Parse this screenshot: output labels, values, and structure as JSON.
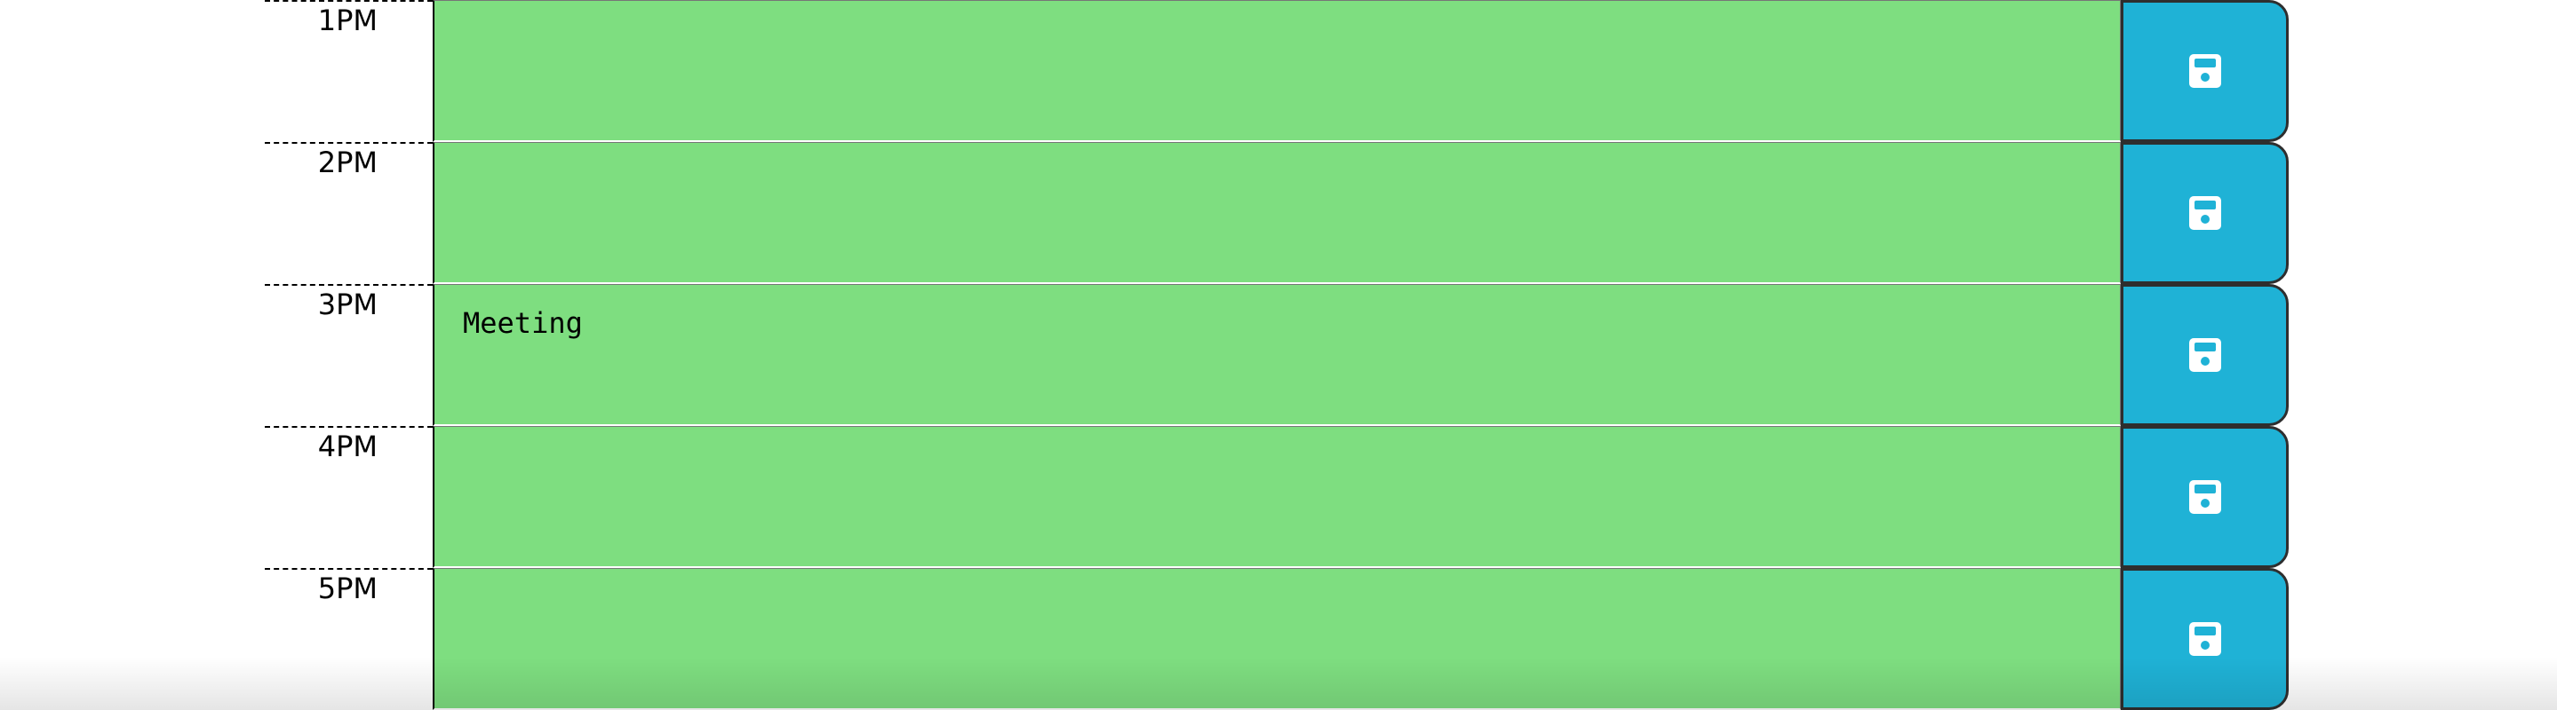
{
  "colors": {
    "present_block": "#7ede80",
    "save_button": "#1fb2d6",
    "save_button_border": "#2e2e2e"
  },
  "timeblocks": [
    {
      "hour": "1PM",
      "description": "",
      "save_icon": "floppy-disk-icon"
    },
    {
      "hour": "2PM",
      "description": "",
      "save_icon": "floppy-disk-icon"
    },
    {
      "hour": "3PM",
      "description": "Meeting",
      "save_icon": "floppy-disk-icon"
    },
    {
      "hour": "4PM",
      "description": "",
      "save_icon": "floppy-disk-icon"
    },
    {
      "hour": "5PM",
      "description": "",
      "save_icon": "floppy-disk-icon"
    }
  ]
}
